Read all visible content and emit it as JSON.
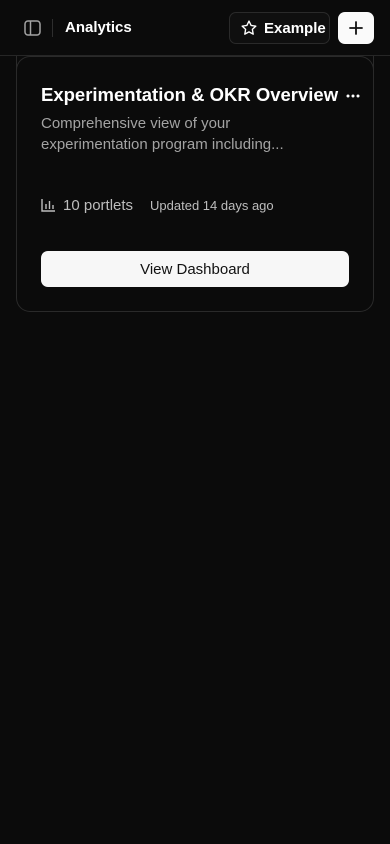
{
  "header": {
    "title": "Analytics",
    "example_label": "Example",
    "icons": {
      "sidebar_toggle": "sidebar-panel-icon",
      "example": "star-icon",
      "add": "plus-icon"
    }
  },
  "dashboard_card": {
    "title": "Experimentation & OKR Overview",
    "description": "Comprehensive view of your experimentation program including...",
    "portlets": "10 portlets",
    "updated": "Updated 14 days ago",
    "view_label": "View Dashboard",
    "icons": {
      "more": "ellipsis-icon",
      "portlets": "bar-chart-icon"
    }
  },
  "colors": {
    "background": "#0b0b0b",
    "border": "#2a2a2a",
    "muted_text": "#a3a3a3",
    "primary_button": "#f7f7f7"
  }
}
